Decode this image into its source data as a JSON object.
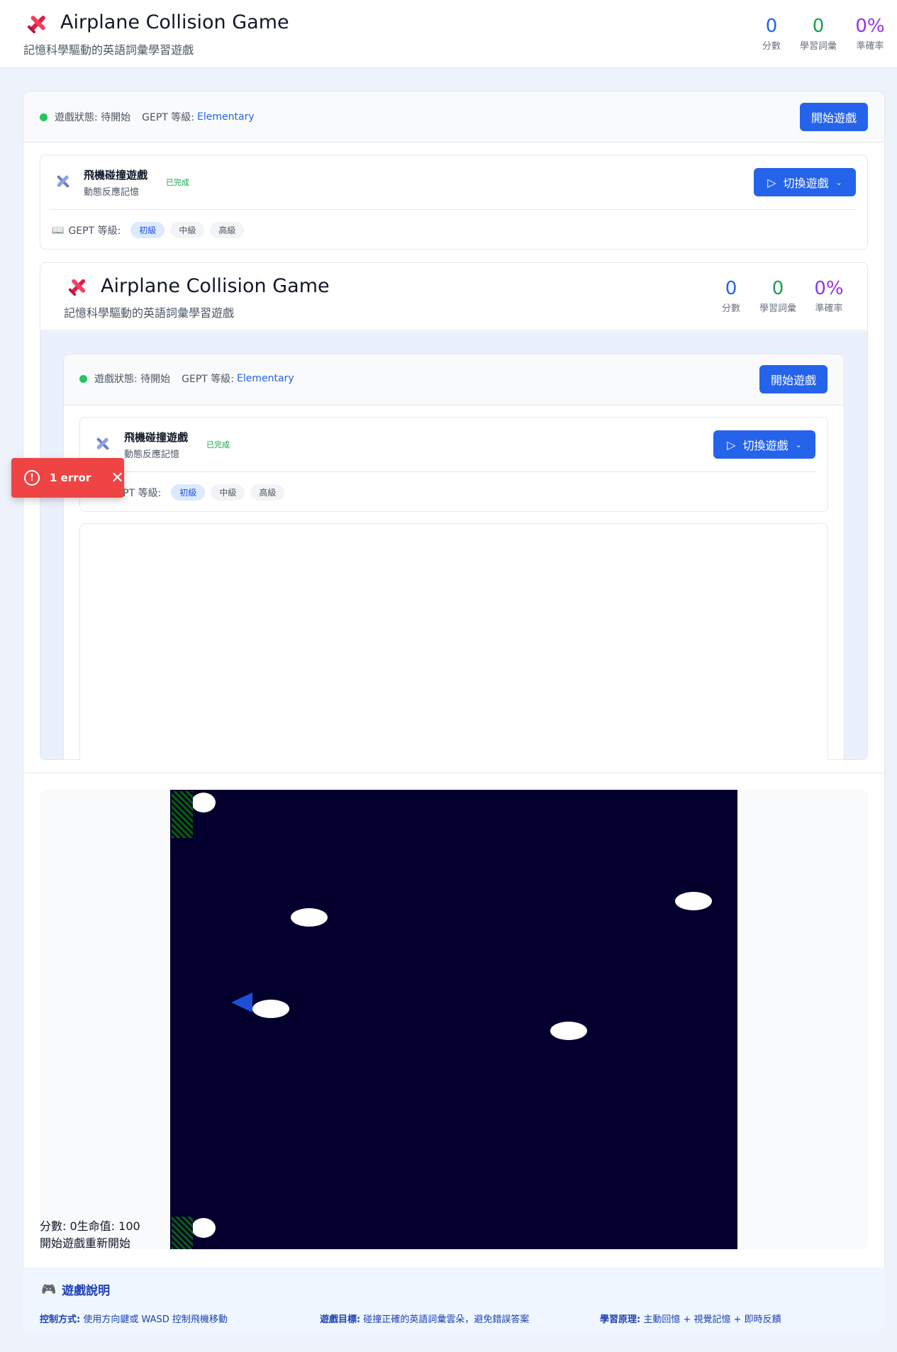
{
  "header": {
    "title": "Airplane Collision Game",
    "subtitle": "記憶科學驅動的英語詞彙學習遊戲",
    "stats": [
      {
        "value": "0",
        "label": "分數",
        "color": "#2563eb"
      },
      {
        "value": "0",
        "label": "學習詞彙",
        "color": "#16a34a"
      },
      {
        "value": "0%",
        "label": "準確率",
        "color": "#9333ea"
      }
    ]
  },
  "status": {
    "state_label": "遊戲狀態: 待開始",
    "level_label": "GEPT 等級:",
    "level_value": "Elementary",
    "start_button": "開始遊戲"
  },
  "game_card": {
    "title": "飛機碰撞遊戲",
    "subtitle": "動態反應記憶",
    "done_label": "已完成",
    "switch_button": "切換遊戲",
    "level_label": "GEPT 等級:",
    "levels": [
      "初級",
      "中級",
      "高級"
    ],
    "active_level": 0
  },
  "error_toast": {
    "text": "1 error"
  },
  "hud": {
    "line1": "分數: 0生命值: 100",
    "line2": "開始遊戲重新開始"
  },
  "instructions": {
    "heading": "遊戲說明",
    "items": [
      {
        "label": "控制方式:",
        "text": "使用方向鍵或 WASD 控制飛機移動"
      },
      {
        "label": "遊戲目標:",
        "text": "碰撞正確的英語詞彙雲朵，避免錯誤答案"
      },
      {
        "label": "學習原理:",
        "text": "主動回憶 + 視覺記憶 + 即時反饋"
      }
    ]
  },
  "colors": {
    "primary": "#2563eb",
    "canvas_bg": "#03002e",
    "error": "#ef4444"
  }
}
